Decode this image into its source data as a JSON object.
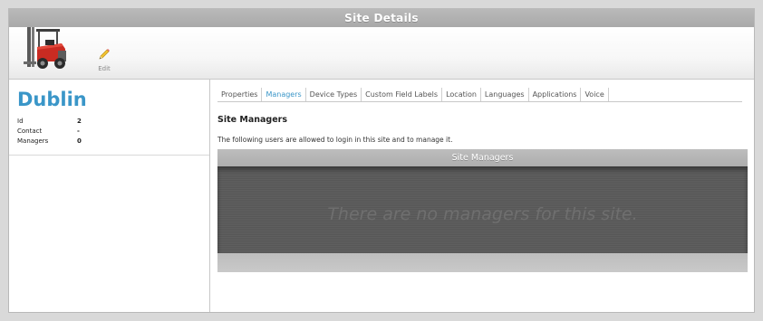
{
  "window": {
    "title": "Site Details"
  },
  "toolbar": {
    "logo_icon": "forklift-icon",
    "edit_icon": "pencil-icon",
    "edit_label": "Edit"
  },
  "site": {
    "name": "Dublin",
    "properties": [
      {
        "key": "Id",
        "value": "2"
      },
      {
        "key": "Contact",
        "value": "-"
      },
      {
        "key": "Managers",
        "value": "0"
      }
    ]
  },
  "tabs": [
    {
      "label": "Properties",
      "active": false
    },
    {
      "label": "Managers",
      "active": true
    },
    {
      "label": "Device Types",
      "active": false
    },
    {
      "label": "Custom Field Labels",
      "active": false
    },
    {
      "label": "Location",
      "active": false
    },
    {
      "label": "Languages",
      "active": false
    },
    {
      "label": "Applications",
      "active": false
    },
    {
      "label": "Voice",
      "active": false
    }
  ],
  "managers": {
    "section_title": "Site Managers",
    "description": "The following users are allowed to login in this site and to manage it.",
    "grid_title": "Site Managers",
    "empty_message": "There are no managers for this site."
  },
  "colors": {
    "accent": "#3a96c8",
    "titlebar": "#b0b0b0",
    "grid_body": "#5b5b5b"
  }
}
